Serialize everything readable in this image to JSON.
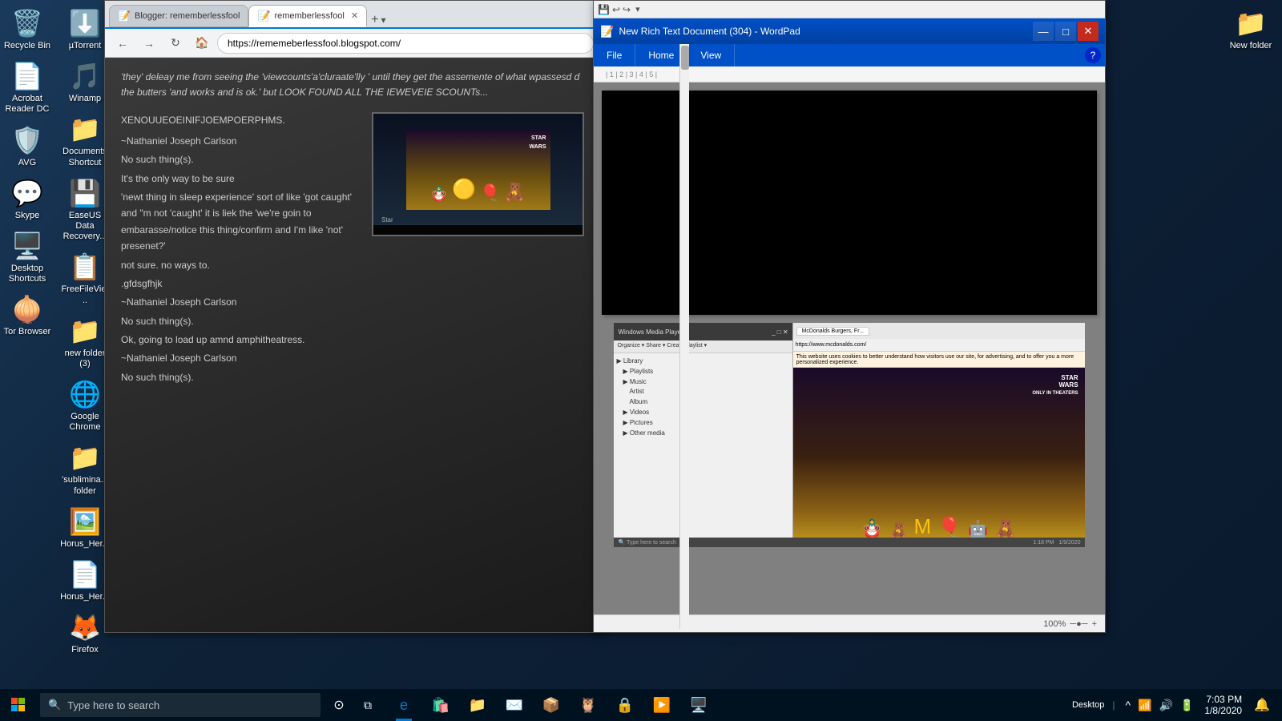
{
  "desktop": {
    "icons": {
      "col1": [
        {
          "id": "recycle-bin",
          "emoji": "🗑️",
          "label": "Recycle Bin",
          "color": "#a8c8f0"
        },
        {
          "id": "acrobat-reader",
          "emoji": "📄",
          "label": "Acrobat Reader DC",
          "color": "#e82020"
        },
        {
          "id": "avg",
          "emoji": "🛡️",
          "label": "AVG",
          "color": "#e82020"
        },
        {
          "id": "skype",
          "emoji": "💬",
          "label": "Skype",
          "color": "#00aff0"
        },
        {
          "id": "desktop-shortcuts",
          "emoji": "🖥️",
          "label": "Desktop Shortcuts",
          "color": "#ffa040"
        },
        {
          "id": "tor-browser",
          "emoji": "🧅",
          "label": "Tor Browser",
          "color": "#7b2fbe"
        }
      ],
      "col2": [
        {
          "id": "utorrent",
          "emoji": "⬇️",
          "label": "µTorrent",
          "color": "#e8a020"
        },
        {
          "id": "winamp",
          "emoji": "🎵",
          "label": "Winamp",
          "color": "#e8a020"
        },
        {
          "id": "documents-shortcut",
          "emoji": "📁",
          "label": "Documents Shortcut",
          "color": "#ffa040"
        },
        {
          "id": "easeus",
          "emoji": "💾",
          "label": "EaseUS Data Recovery...",
          "color": "#40a0e0"
        },
        {
          "id": "freefileview",
          "emoji": "📋",
          "label": "FreeFileVie...",
          "color": "#40a0e0"
        },
        {
          "id": "new-folder",
          "emoji": "📁",
          "label": "new folder (3)",
          "color": "#ffa040"
        },
        {
          "id": "google-chrome-icon",
          "emoji": "🌐",
          "label": "Google Chrome",
          "color": "#4285f4"
        },
        {
          "id": "sublimina-folder",
          "emoji": "📁",
          "label": "'sublimina... folder",
          "color": "#ffa040"
        },
        {
          "id": "horus-her",
          "emoji": "🖼️",
          "label": "Horus_Her...",
          "color": "#aaaaaa"
        },
        {
          "id": "horus-pdf",
          "emoji": "📄",
          "label": "Horus_Her...",
          "color": "#e82020"
        },
        {
          "id": "firefox",
          "emoji": "🦊",
          "label": "Firefox",
          "color": "#ff7820"
        }
      ],
      "topright": {
        "id": "new-folder-top",
        "emoji": "📁",
        "label": "New folder",
        "color": "#ffa040"
      }
    }
  },
  "browser": {
    "tabs": [
      {
        "label": "Blogger: rememberlessfool",
        "active": false,
        "favicon": "📝"
      },
      {
        "label": "rememberlessfool",
        "active": true,
        "favicon": "📝"
      }
    ],
    "url": "https://rememeberlessfool.blogspot.com/",
    "content": {
      "header_text": "'they' deleay me from seeing the 'viewcounts'a'cluraate'lly ' until they get the assemente of what wpassesd d the butters 'and works and is ok.' but LOOK FOUND ALL THE IEWEVEIE SCOUNTs...",
      "blog_lines": [
        "XENOUUEOEINIFJOEMPOERPHMS.",
        "~Nathaniel Joseph Carlson",
        "No such thing(s).",
        "It's the only way to be sure",
        "'newt thing in sleep experience' sort of like 'got caught' and \"m not 'caught' it is liek the 'we're goin to embarasse/notice this thing/confirm and I'm like 'not' presenet?'",
        "not sure. no ways to.",
        ".gfdsgfhjk",
        "~Nathaniel Joseph Carlson",
        "No such thing(s).",
        "Ok, going to load up amnd amphitheatress.",
        "~Nathaniel Joseph Carlson",
        "No such thing(s)."
      ]
    }
  },
  "wordpad": {
    "title": "New Rich Text Document (304) - WordPad",
    "ribbon_tabs": [
      "File",
      "Home",
      "View"
    ],
    "status": "100%",
    "zoom": "100%"
  },
  "taskbar": {
    "search_placeholder": "Type here to search",
    "apps": [
      "edge",
      "store",
      "files",
      "mail",
      "amazon",
      "tripadvisor",
      "vpn",
      "media-player",
      "unknown"
    ],
    "clock_time": "7:03 PM",
    "clock_date": "1/8/2020",
    "show_desktop": "Desktop"
  }
}
